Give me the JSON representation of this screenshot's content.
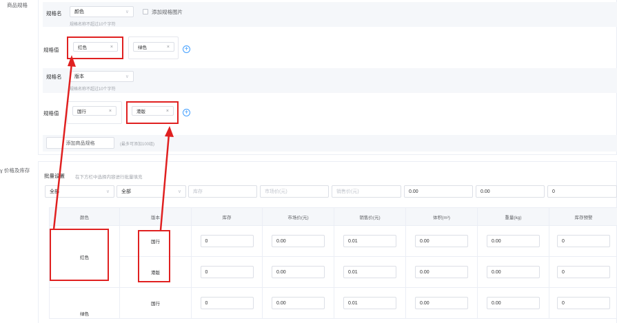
{
  "spec_section": {
    "label": "商品规格",
    "groups": [
      {
        "name_label": "规格名",
        "name_value": "颜色",
        "name_hint": "规格名称不超过10个字符",
        "add_image_label": "添加规格图片",
        "value_label": "规格值",
        "values": [
          "红色",
          "绿色"
        ]
      },
      {
        "name_label": "规格名",
        "name_value": "版本",
        "name_hint": "规格名称不超过10个字符",
        "value_label": "规格值",
        "values": [
          "国行",
          "港版"
        ]
      }
    ],
    "add_spec_button": "添加商品规格",
    "add_spec_hint": "(最多可添加100组)"
  },
  "price_section": {
    "label": "价格及库存",
    "batch_label": "批量设置",
    "batch_hint": "在下方栏中选择内容进行批量填充",
    "batch_selects": [
      "全部",
      "全部"
    ],
    "batch_placeholders": [
      "库存",
      "市场价(元)",
      "销售价(元)"
    ],
    "batch_values": [
      "0.00",
      "0.00",
      "0"
    ]
  },
  "table": {
    "headers": [
      "颜色",
      "版本",
      "库存",
      "市场价(元)",
      "销售价(元)",
      "体积(m³)",
      "重量(kg)",
      "库存预警"
    ],
    "groups": [
      {
        "color": "红色",
        "rows": [
          {
            "version": "国行",
            "values": [
              "0",
              "0.00",
              "0.01",
              "0.00",
              "0.00",
              "0"
            ]
          },
          {
            "version": "港版",
            "values": [
              "0",
              "0.00",
              "0.01",
              "0.00",
              "0.00",
              "0"
            ]
          }
        ]
      },
      {
        "color": "绿色",
        "rows": [
          {
            "version": "国行",
            "values": [
              "0",
              "0.00",
              "0.01",
              "0.00",
              "0.00",
              "0"
            ]
          }
        ]
      }
    ]
  },
  "colors": {
    "annotation_red": "#e02020",
    "accent_blue": "#409eff",
    "panel_bg": "#f5f7fa",
    "border": "#dcdfe6"
  }
}
